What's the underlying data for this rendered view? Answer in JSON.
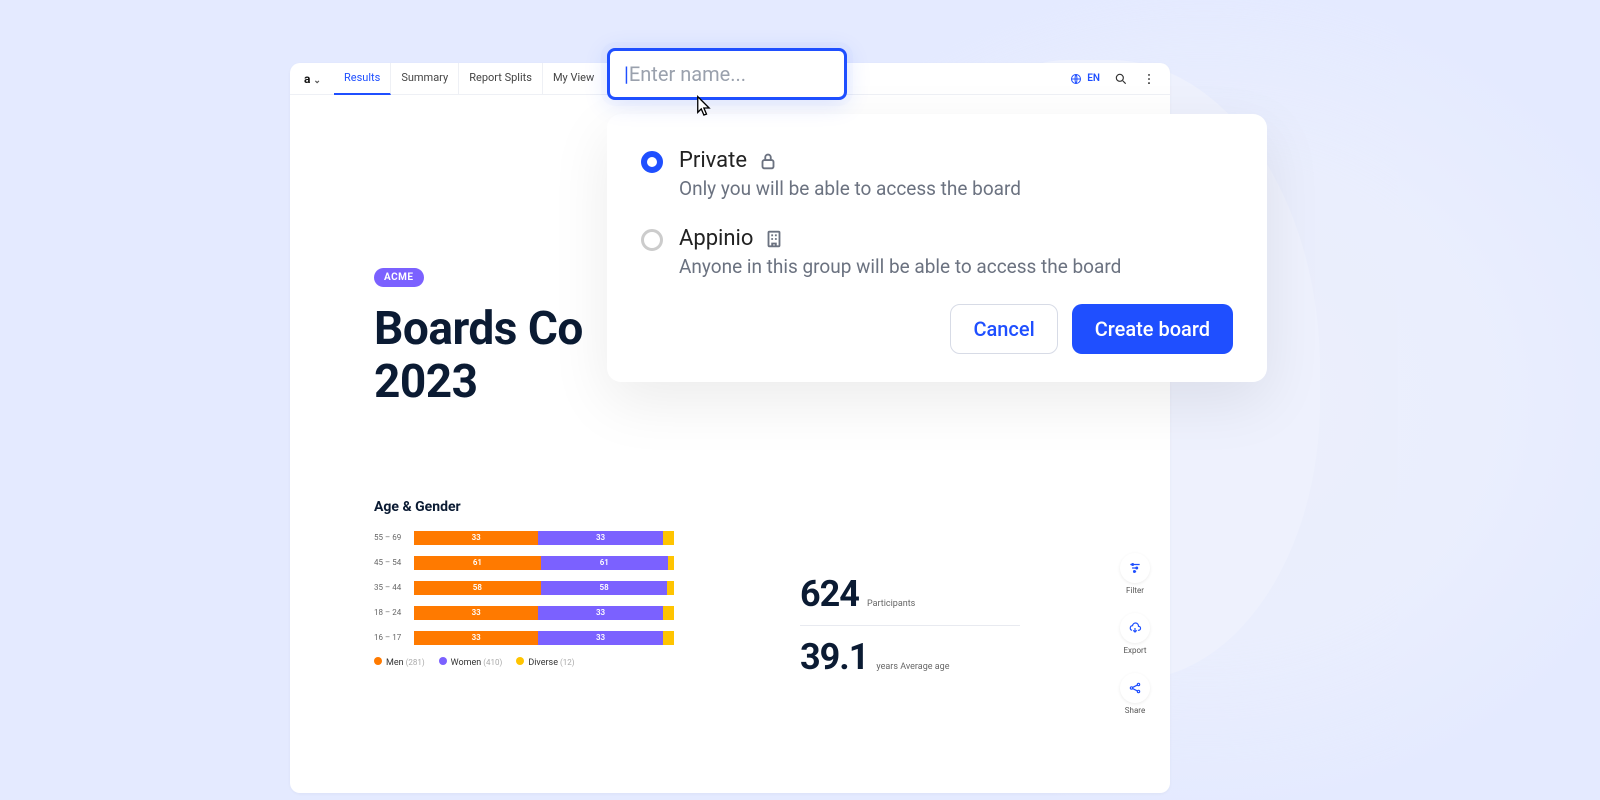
{
  "nav": {
    "tabs": [
      "Results",
      "Summary",
      "Report Splits",
      "My View"
    ],
    "active_tab_index": 0,
    "language": "EN"
  },
  "page": {
    "badge": "ACME",
    "headline_line1": "Boards Co",
    "headline_line2": "2023"
  },
  "chart_data": {
    "type": "bar",
    "title": "Age & Gender",
    "stacking": "horizontal",
    "categories": [
      "55 – 69",
      "45 – 54",
      "35 – 44",
      "18 – 24",
      "16 – 17"
    ],
    "series": [
      {
        "name": "Men",
        "color": "#ff7a00",
        "values": [
          33,
          61,
          58,
          33,
          33
        ],
        "total": 281
      },
      {
        "name": "Women",
        "color": "#7b61ff",
        "values": [
          33,
          61,
          58,
          33,
          33
        ],
        "total": 410
      },
      {
        "name": "Diverse",
        "color": "#ffc400",
        "values": [
          3,
          3,
          3,
          3,
          3
        ],
        "total": 12
      }
    ],
    "legend": [
      "Men",
      "Women",
      "Diverse"
    ]
  },
  "stats": {
    "participants": {
      "value": "624",
      "label": "Participants"
    },
    "avg_age": {
      "value": "39.1",
      "label": "years Average age"
    }
  },
  "side_actions": {
    "filter": "Filter",
    "export": "Export",
    "share": "Share"
  },
  "modal": {
    "input_placeholder": "Enter name...",
    "options": [
      {
        "key": "private",
        "title": "Private",
        "desc": "Only you will be able to access the board",
        "icon": "lock",
        "selected": true
      },
      {
        "key": "group",
        "title": "Appinio",
        "desc": "Anyone in this group will be able to access the board",
        "icon": "building",
        "selected": false
      }
    ],
    "cancel": "Cancel",
    "confirm": "Create board"
  }
}
